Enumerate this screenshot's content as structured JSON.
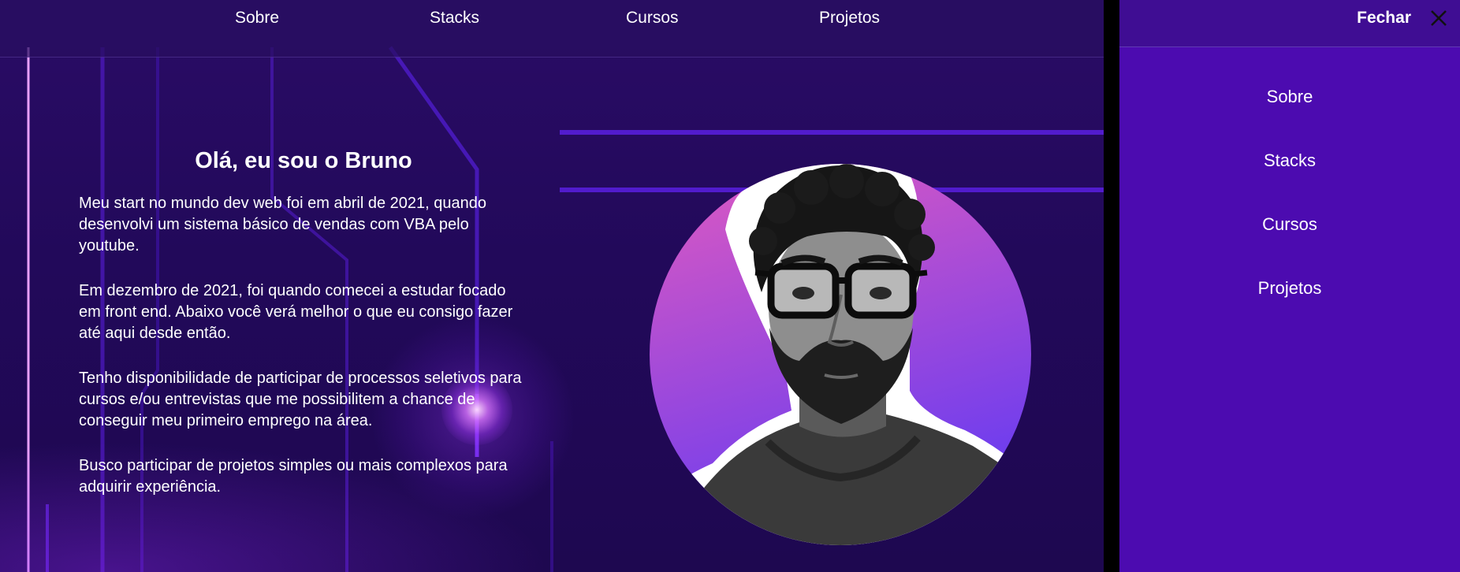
{
  "nav": {
    "items": [
      {
        "label": "Sobre"
      },
      {
        "label": "Stacks"
      },
      {
        "label": "Cursos"
      },
      {
        "label": "Projetos"
      }
    ]
  },
  "intro": {
    "heading": "Olá, eu sou o Bruno",
    "paragraphs": [
      "Meu start no mundo dev web foi em abril de 2021, quando desenvolvi um sistema básico de vendas com VBA pelo youtube.",
      "Em dezembro de 2021, foi quando comecei a estudar focado em front end. Abaixo você verá melhor o que eu consigo fazer até aqui desde então.",
      "Tenho disponibilidade de participar de processos seletivos para cursos e/ou entrevistas que me possibilitem a chance de conseguir meu primeiro emprego na área.",
      "Busco participar de projetos simples ou mais complexos para adquirir experiência."
    ]
  },
  "drawer": {
    "close_label": "Fechar",
    "close_icon": "close-icon",
    "items": [
      {
        "label": "Sobre"
      },
      {
        "label": "Stacks"
      },
      {
        "label": "Cursos"
      },
      {
        "label": "Projetos"
      }
    ]
  },
  "colors": {
    "background": "#22095a",
    "drawer": "#4c0bb0",
    "drawer_header": "#3f0d93",
    "avatar_gradient_top": "#e05ac0",
    "avatar_gradient_bottom": "#6a3cf0"
  }
}
